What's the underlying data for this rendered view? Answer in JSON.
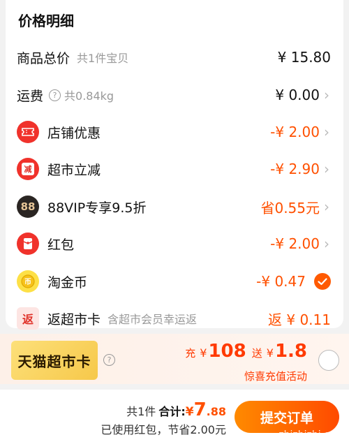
{
  "header": {
    "title": "价格明细"
  },
  "rows": {
    "total": {
      "label": "商品总价",
      "sub": "共1件宝贝",
      "amount": "¥ 15.80"
    },
    "shipping": {
      "label": "运费",
      "sub": "共0.84kg",
      "amount": "¥ 0.00"
    },
    "shop_discount": {
      "label": "店铺优惠",
      "icon": "coupon-icon",
      "amount": "-¥ 2.00"
    },
    "market_discount": {
      "label": "超市立减",
      "icon": "discount-stamp-icon",
      "icon_text": "减",
      "amount": "-¥ 2.90"
    },
    "vip": {
      "label": "88VIP专享9.5折",
      "icon": "vip-badge-icon",
      "icon_text": "88",
      "amount": "省0.55元"
    },
    "redpacket": {
      "label": "红包",
      "icon": "red-packet-icon",
      "amount": "-¥ 2.00"
    },
    "taojinbi": {
      "label": "淘金币",
      "icon": "gold-coin-icon",
      "amount": "-¥ 0.47",
      "checked": true
    },
    "cashback": {
      "label": "返超市卡",
      "icon": "return-badge-icon",
      "icon_text": "返",
      "sub": "含超市会员幸运返",
      "amount": "返 ¥ 0.11"
    }
  },
  "promo": {
    "card_label": "天猫超市卡",
    "prefix": "充",
    "currency1": "¥",
    "amount1": "108",
    "middle": "送",
    "currency2": "¥",
    "amount2": "1.8",
    "caption": "惊喜充值活动",
    "selected": false
  },
  "footer": {
    "count": "共1件",
    "total_label": "合计:",
    "currency": "¥",
    "total_int": "7",
    "total_dec": ".88",
    "savings": "已使用红包，节省2.00元",
    "submit_label": "提交订单",
    "watermark": "zhizhizhi.com"
  },
  "colors": {
    "accent": "#ff5000",
    "promo_bg": "#fdf0e8",
    "gold": "#fde046"
  }
}
